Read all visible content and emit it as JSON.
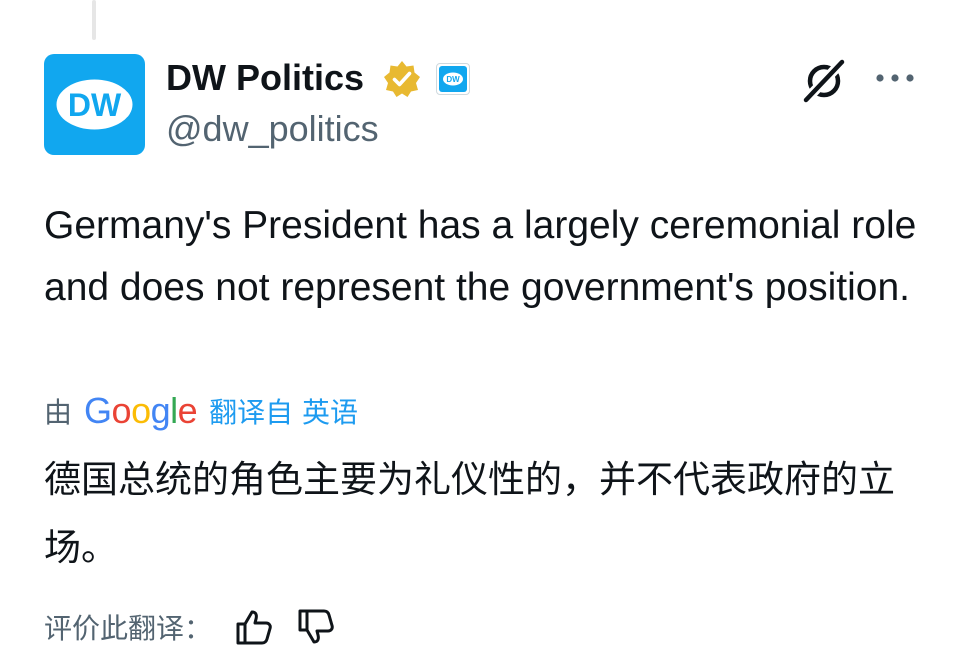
{
  "author": {
    "display_name": "DW Politics",
    "handle": "@dw_politics",
    "avatar_logo_text": "DW",
    "badge_color": "#e8b931",
    "brand_color": "#11a7ef"
  },
  "post": {
    "text": "Germany's President has a largely ceremonial role and does not represent the government's position."
  },
  "translation": {
    "by_label": "由",
    "provider": "Google",
    "provider_letters": [
      "G",
      "o",
      "o",
      "g",
      "l",
      "e"
    ],
    "provider_colors": [
      "#4285f4",
      "#ea4335",
      "#fbbc05",
      "#4285f4",
      "#34a853",
      "#ea4335"
    ],
    "source_label": "翻译自 英语",
    "text": "德国总统的角色主要为礼仪性的，并不代表政府的立场。"
  },
  "rating": {
    "label": "评价此翻译："
  },
  "icons": {
    "grok": "grok-icon",
    "more": "more-icon",
    "verified": "verified-badge-icon",
    "affiliate": "affiliate-badge-icon",
    "thumbs_up": "thumbs-up-icon",
    "thumbs_down": "thumbs-down-icon"
  }
}
